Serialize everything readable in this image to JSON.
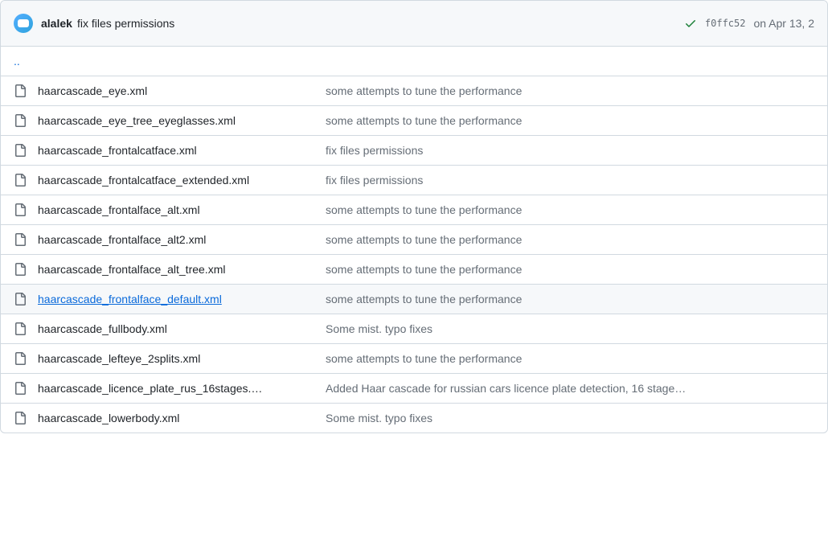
{
  "header": {
    "author": "alalek",
    "message": "fix files permissions",
    "commit_hash": "f0ffc52",
    "date": "on Apr 13, 2"
  },
  "parent_link": "..",
  "files": [
    {
      "name": "haarcascade_eye.xml",
      "message": "some attempts to tune the performance",
      "hovered": false
    },
    {
      "name": "haarcascade_eye_tree_eyeglasses.xml",
      "message": "some attempts to tune the performance",
      "hovered": false
    },
    {
      "name": "haarcascade_frontalcatface.xml",
      "message": "fix files permissions",
      "hovered": false
    },
    {
      "name": "haarcascade_frontalcatface_extended.xml",
      "message": "fix files permissions",
      "hovered": false
    },
    {
      "name": "haarcascade_frontalface_alt.xml",
      "message": "some attempts to tune the performance",
      "hovered": false
    },
    {
      "name": "haarcascade_frontalface_alt2.xml",
      "message": "some attempts to tune the performance",
      "hovered": false
    },
    {
      "name": "haarcascade_frontalface_alt_tree.xml",
      "message": "some attempts to tune the performance",
      "hovered": false
    },
    {
      "name": "haarcascade_frontalface_default.xml",
      "message": "some attempts to tune the performance",
      "hovered": true
    },
    {
      "name": "haarcascade_fullbody.xml",
      "message": "Some mist. typo fixes",
      "hovered": false
    },
    {
      "name": "haarcascade_lefteye_2splits.xml",
      "message": "some attempts to tune the performance",
      "hovered": false
    },
    {
      "name": "haarcascade_licence_plate_rus_16stages.…",
      "message": "Added Haar cascade for russian cars licence plate detection, 16 stage…",
      "hovered": false
    },
    {
      "name": "haarcascade_lowerbody.xml",
      "message": "Some mist. typo fixes",
      "hovered": false
    }
  ]
}
